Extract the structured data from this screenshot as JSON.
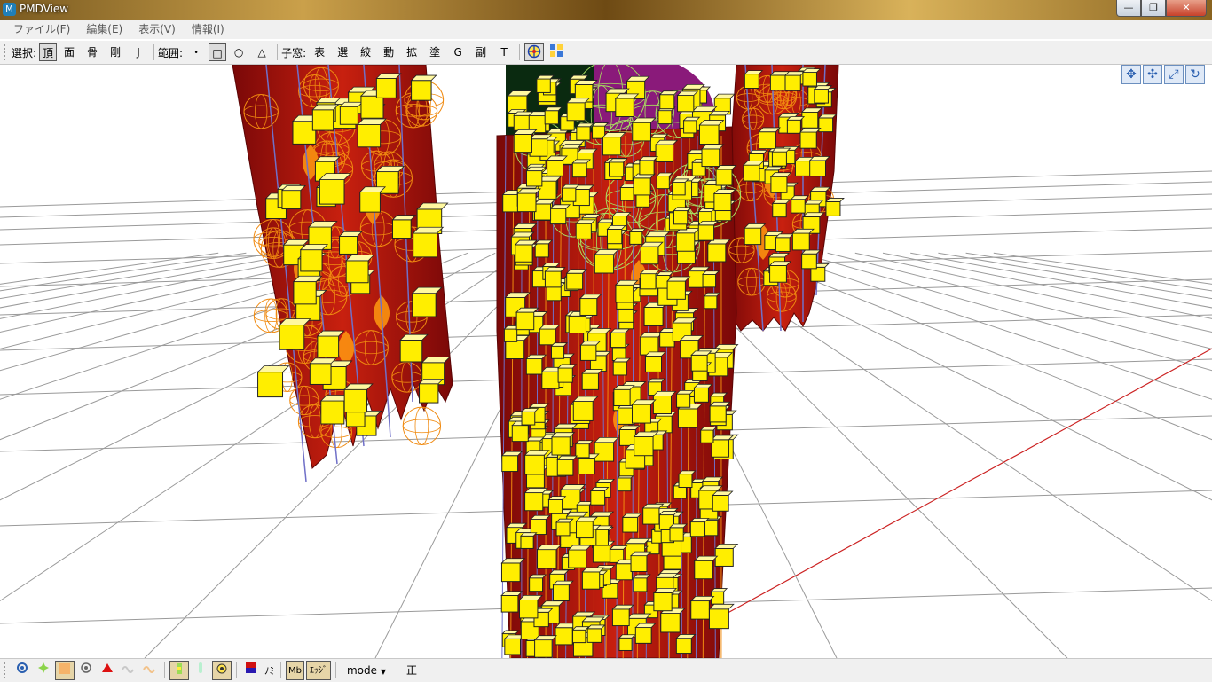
{
  "window": {
    "title": "PMDView",
    "app_icon": "M",
    "min": "—",
    "max": "❐",
    "close": "✕"
  },
  "menu": [
    {
      "label": "ファイル(F)"
    },
    {
      "label": "編集(E)"
    },
    {
      "label": "表示(V)"
    },
    {
      "label": "情報(I)"
    }
  ],
  "toolbar": {
    "select_label": "選択:",
    "select_items": [
      "頂",
      "面",
      "骨",
      "剛",
      "J"
    ],
    "range_label": "範囲:",
    "range_items": [
      "・",
      "□",
      "○",
      "△"
    ],
    "child_label": "子窓:",
    "child_items": [
      "表",
      "選",
      "絞",
      "動",
      "拡",
      "塗",
      "G",
      "副",
      "T"
    ]
  },
  "status": {
    "nomi": "ﾉﾐ",
    "mb": "Mb",
    "edge": "ｴｯｼﾞ",
    "mode": "mode",
    "sei": "正"
  },
  "colors": {
    "grid": "#9a9a9a",
    "axis": "#cc2222",
    "cloth_dark": "#7a0808",
    "cloth": "#c8200f",
    "flame": "#ff9a10",
    "joint": "#ffee00",
    "wire_orange": "#f08a10",
    "wire_green": "#a8e060",
    "bone": "#7070c8",
    "purple": "#8a1a7a"
  },
  "icons": {
    "viewport_buttons": [
      "move-cross-icon",
      "move-arrows-icon",
      "scale-icon",
      "rotate-icon"
    ]
  }
}
